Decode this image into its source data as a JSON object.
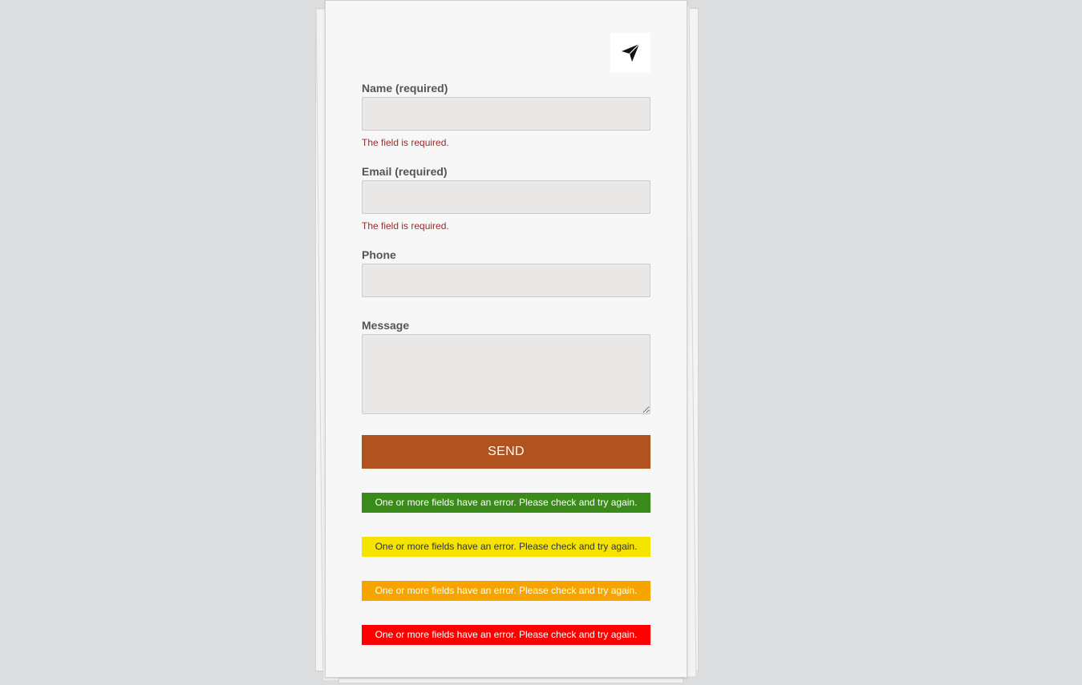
{
  "logo": {
    "icon": "navigation-arrow-icon"
  },
  "form": {
    "name": {
      "label": "Name (required)",
      "value": "",
      "error": "The field is required."
    },
    "email": {
      "label": "Email (required)",
      "value": "",
      "error": "The field is required."
    },
    "phone": {
      "label": "Phone",
      "value": ""
    },
    "message": {
      "label": "Message",
      "value": ""
    },
    "submit_label": "SEND"
  },
  "alerts": [
    {
      "text": "One or more fields have an error. Please check and try again.",
      "bg": "#3b8b1a",
      "color": "#ffffff"
    },
    {
      "text": "One or more fields have an error. Please check and try again.",
      "bg": "#f4e400",
      "color": "#333333"
    },
    {
      "text": "One or more fields have an error. Please check and try again.",
      "bg": "#f7a400",
      "color": "#ffffff"
    },
    {
      "text": "One or more fields have an error. Please check and try again.",
      "bg": "#ff0000",
      "color": "#ffffff"
    }
  ],
  "colors": {
    "page_bg": "#dcdddf",
    "card_bg": "#f7f7f7",
    "input_bg": "#e9e8e6",
    "button_bg": "#b1531f",
    "error_text": "#9a2a2a"
  }
}
